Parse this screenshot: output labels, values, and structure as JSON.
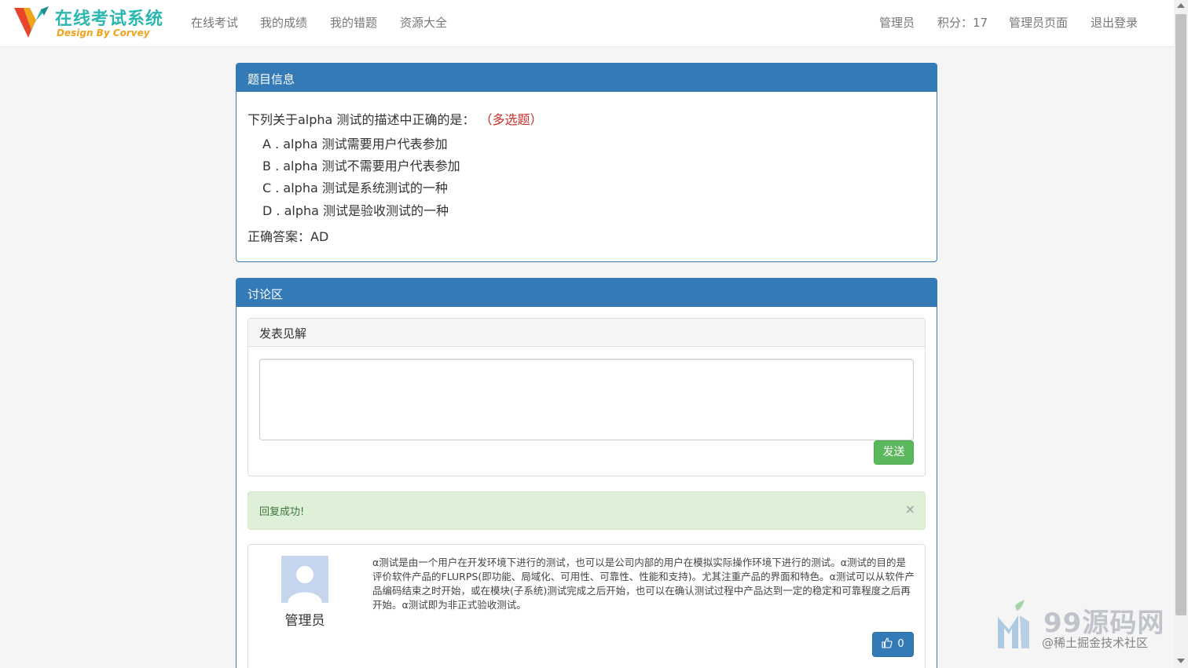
{
  "navbar": {
    "logo_title": "在线考试系统",
    "logo_subtitle": "Design By Corvey",
    "items": [
      {
        "label": "在线考试"
      },
      {
        "label": "我的成绩"
      },
      {
        "label": "我的错题"
      },
      {
        "label": "资源大全"
      }
    ],
    "user": "管理员",
    "points_label": "积分：17",
    "admin_page": "管理员页面",
    "logout": "退出登录"
  },
  "question_panel": {
    "heading": "题目信息",
    "question": "下列关于alpha 测试的描述中正确的是：",
    "type": "（多选题）",
    "options": [
      {
        "text": "A . alpha 测试需要用户代表参加"
      },
      {
        "text": "B . alpha 测试不需要用户代表参加"
      },
      {
        "text": "C . alpha 测试是系统测试的一种"
      },
      {
        "text": "D . alpha 测试是验收测试的一种"
      }
    ],
    "answer": "正确答案：AD"
  },
  "discussion_panel": {
    "heading": "讨论区",
    "compose_heading": "发表见解",
    "textarea_value": "",
    "send_label": "发送",
    "alert_text": "回复成功!",
    "alert_close": "×",
    "comments": [
      {
        "author": "管理员",
        "text": "α测试是由一个用户在开发环境下进行的测试，也可以是公司内部的用户在模拟实际操作环境下进行的测试。α测试的目的是评价软件产品的FLURPS(即功能、局域化、可用性、可靠性、性能和支持)。尤其注重产品的界面和特色。α测试可以从软件产品编码结束之时开始，或在模块(子系统)测试完成之后开始，也可以在确认测试过程中产品达到一定的稳定和可靠程度之后再开始。α测试即为非正式验收测试。",
        "likes": "0"
      }
    ]
  },
  "watermark": {
    "title": "99源码网",
    "subtitle": "@稀土掘金技术社区"
  },
  "colors": {
    "primary": "#337ab7",
    "success": "#5cb85c",
    "alert_bg": "#dff0d8",
    "qtype_red": "#c9302c",
    "logo_teal": "#2bb6b0",
    "logo_orange": "#f0a31b"
  }
}
